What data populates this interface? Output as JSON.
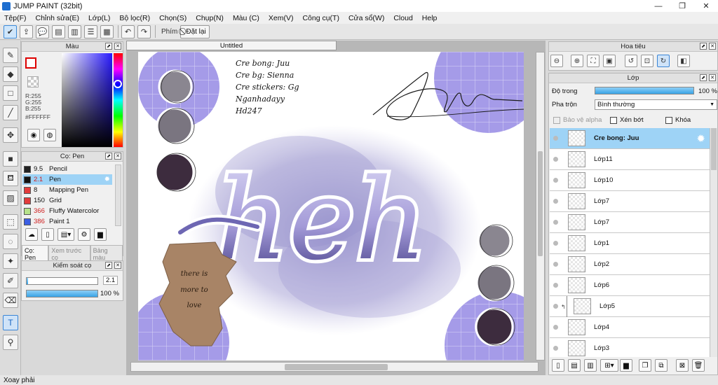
{
  "window": {
    "title": "JUMP PAINT (32bit)",
    "minimize": "—",
    "maximize": "❐",
    "close": "✕"
  },
  "menu": [
    "Tệp(F)",
    "Chỉnh sửa(E)",
    "Lớp(L)",
    "Bộ lọc(R)",
    "Chọn(S)",
    "Chụp(N)",
    "Màu (C)",
    "Xem(V)",
    "Công cụ(T)",
    "Cửa sổ(W)",
    "Cloud",
    "Help"
  ],
  "toolbar": {
    "pen_label": "Phím",
    "reset_label": "Đặt lại"
  },
  "color_panel": {
    "title": "Màu",
    "r": "R:255",
    "g": "G:255",
    "b": "B:255",
    "hex": "#FFFFFF",
    "foreground": "#ffffff",
    "accent": "#2a1bff"
  },
  "brush_panel": {
    "title": "Cọ: Pen",
    "brushes": [
      {
        "size": "9.5",
        "name": "Pencil",
        "color": "#222222"
      },
      {
        "size": "2.1",
        "name": "Pen",
        "color": "#111111",
        "selected": true
      },
      {
        "size": "8",
        "name": "Mapping Pen",
        "color": "#e33b3b"
      },
      {
        "size": "150",
        "name": "Grid",
        "color": "#e33b3b"
      },
      {
        "size": "366",
        "name": "Fluffy Watercolor",
        "color": "#b6e28a"
      },
      {
        "size": "386",
        "name": "Paint 1",
        "color": "#3b5ee3"
      }
    ],
    "tabs": [
      "Cọ: Pen",
      "Xem trước cọ",
      "Bảng màu"
    ]
  },
  "brush_control": {
    "title": "Kiểm soát cọ",
    "size_value": "2.1",
    "opacity_value": "100 %",
    "opacity_level": 1.0,
    "size_level": 0.02
  },
  "document": {
    "tab_title": "Untitled"
  },
  "canvas_art": {
    "credits": [
      "Cre bong: Juu",
      "Cre bg: Sienna",
      "Cre stickers: Gg",
      "Nganhadayy",
      "Hd247"
    ],
    "lettering": "heh",
    "note": [
      "there is",
      "more to",
      "love"
    ],
    "swatch_colors": [
      "#8a8690",
      "#7a7580",
      "#3d2c3e"
    ],
    "bg_color": "#a59be8"
  },
  "navigator": {
    "title": "Hoa tiêu"
  },
  "layer_panel": {
    "title": "Lớp",
    "opacity_label": "Độ trong",
    "opacity_value": "100 %",
    "blend_label": "Pha trộn",
    "blend_value": "Bình thường",
    "protect_alpha": "Bảo vệ alpha",
    "clipping": "Xén bớt",
    "lock": "Khóa",
    "layers": [
      {
        "name": "Cre bong: Juu",
        "selected": true
      },
      {
        "name": "Lớp11"
      },
      {
        "name": "Lớp10"
      },
      {
        "name": "Lớp7"
      },
      {
        "name": "Lớp7"
      },
      {
        "name": "Lớp1"
      },
      {
        "name": "Lớp2"
      },
      {
        "name": "Lớp6"
      },
      {
        "name": "Lớp5",
        "clipped": true
      },
      {
        "name": "Lớp4"
      },
      {
        "name": "Lớp3"
      }
    ]
  },
  "status": {
    "text": "Xoay phải"
  }
}
